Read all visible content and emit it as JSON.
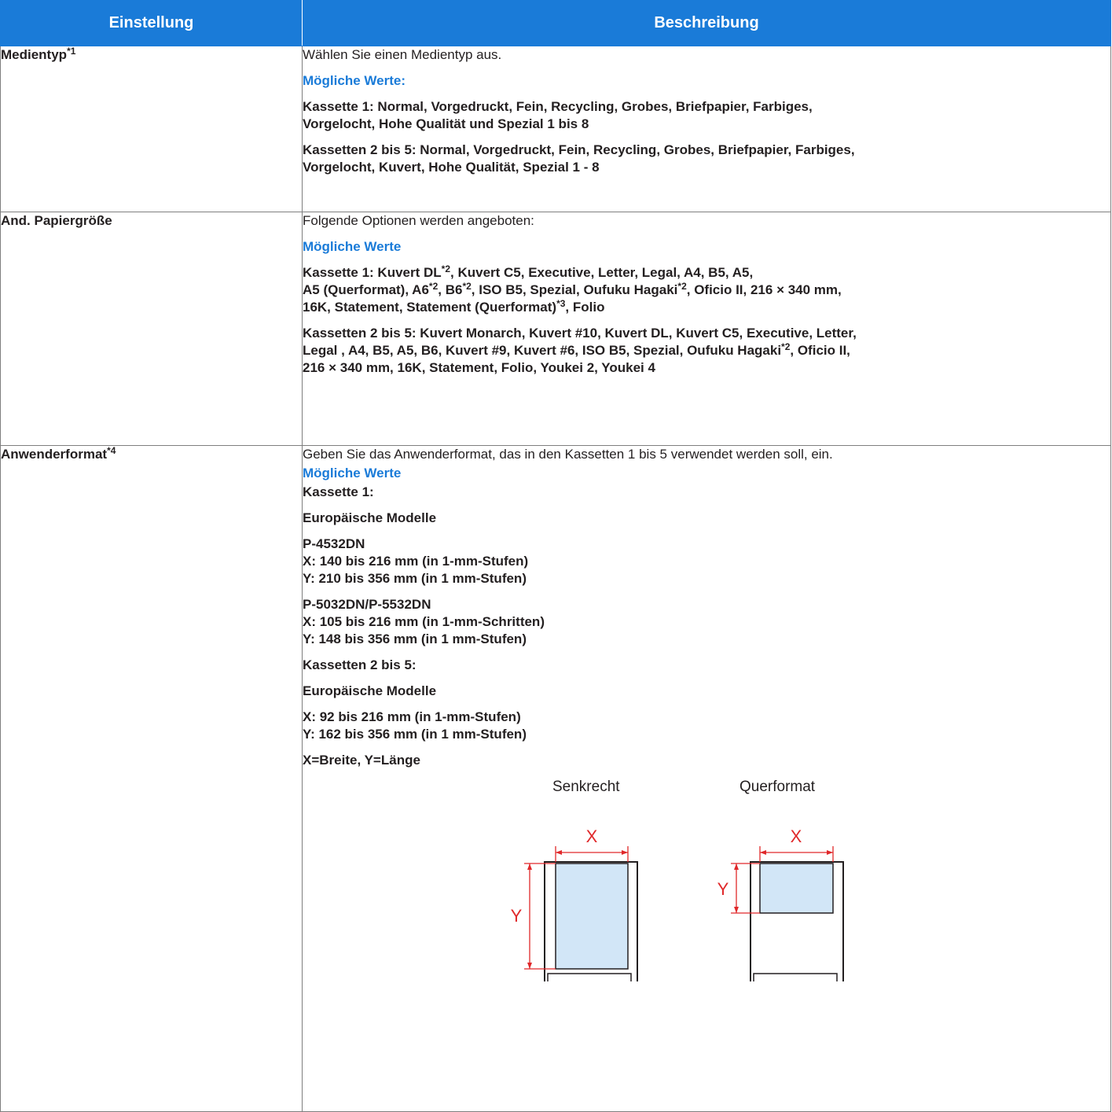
{
  "table": {
    "header": {
      "setting": "Einstellung",
      "description": "Beschreibung"
    },
    "rows": [
      {
        "setting": "Medientyp",
        "setting_sup": "*1",
        "intro": "Wählen Sie einen Medientyp aus.",
        "values_label": "Mögliche Werte:",
        "para1": "Kassette 1: Normal, Vorgedruckt, Fein, Recycling, Grobes, Briefpapier, Farbiges,",
        "para1b": "Vorgelocht, Hohe Qualität und Spezial 1 bis 8",
        "para2": "Kassetten 2 bis 5: Normal, Vorgedruckt, Fein, Recycling, Grobes, Briefpapier, Farbiges,",
        "para2b": "Vorgelocht, Kuvert, Hohe Qualität, Spezial 1 - 8"
      },
      {
        "setting": "And. Papiergröße",
        "intro": "Folgende Optionen werden angeboten:",
        "values_label": "Mögliche Werte",
        "k1": {
          "a": "Kassette 1: Kuvert DL",
          "a_sup": "*2",
          "b": ", Kuvert C5, Executive, Letter, Legal, A4, B5, A5,",
          "c": "A5 (Querformat), A6",
          "c_sup": "*2",
          "d": ", B6",
          "d_sup": "*2",
          "e": ", ISO B5, Spezial, Oufuku Hagaki",
          "e_sup": "*2",
          "f": ", Oficio II, 216 × 340 mm,",
          "g": "16K, Statement, Statement (Querformat)",
          "g_sup": "*3",
          "h": ", Folio"
        },
        "k2": {
          "a": "Kassetten 2 bis 5: Kuvert Monarch, Kuvert #10, Kuvert DL, Kuvert C5, Executive, Letter,",
          "b": "Legal , A4, B5, A5, B6, Kuvert #9, Kuvert #6, ISO B5, Spezial, Oufuku Hagaki",
          "b_sup": "*2",
          "c": ", Oficio II,",
          "d": "216 × 340 mm, 16K, Statement, Folio, Youkei 2, Youkei 4"
        }
      },
      {
        "setting": "Anwenderformat",
        "setting_sup": "*4",
        "intro": "Geben Sie das Anwenderformat, das in den Kassetten 1 bis 5 verwendet werden soll, ein.",
        "values_label": "Mögliche Werte",
        "k1_label": "Kassette 1:",
        "eu_label": "Europäische Modelle",
        "m1": {
          "name": "P-4532DN",
          "x": "X: 140 bis 216 mm (in 1-mm-Stufen)",
          "y": "Y: 210 bis 356 mm (in 1 mm-Stufen)"
        },
        "m2": {
          "name": "P-5032DN/P-5532DN",
          "x": "X: 105 bis 216 mm (in 1-mm-Schritten)",
          "y": "Y: 148 bis 356 mm (in 1 mm-Stufen)"
        },
        "k2_label": "Kassetten 2 bis 5:",
        "eu_label2": "Europäische Modelle",
        "k2x": "X: 92 bis 216 mm (in 1-mm-Stufen)",
        "k2y": "Y: 162 bis 356 mm (in 1 mm-Stufen)",
        "xy_note": "X=Breite, Y=Länge",
        "figure": {
          "portrait_caption": "Senkrecht",
          "landscape_caption": "Querformat",
          "x_letter": "X",
          "y_letter": "Y",
          "dim_color": "#e0282a",
          "paper_fill": "#d2e6f7"
        }
      }
    ]
  }
}
